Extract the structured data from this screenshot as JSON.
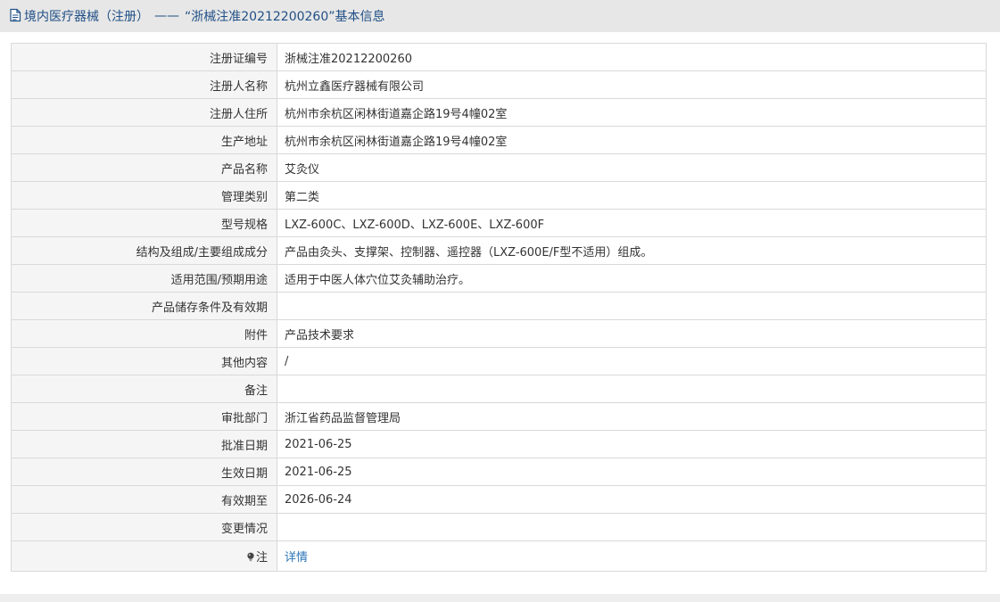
{
  "header": {
    "category": "境内医疗器械（注册）",
    "separator": "——",
    "title": "“浙械注准20212200260”基本信息",
    "icon": "document-icon"
  },
  "rows": [
    {
      "key": "registration-number",
      "label": "注册证编号",
      "value": "浙械注准20212200260"
    },
    {
      "key": "registrant-name",
      "label": "注册人名称",
      "value": "杭州立鑫医疗器械有限公司"
    },
    {
      "key": "registrant-address",
      "label": "注册人住所",
      "value": "杭州市余杭区闲林街道嘉企路19号4幢02室"
    },
    {
      "key": "production-address",
      "label": "生产地址",
      "value": "杭州市余杭区闲林街道嘉企路19号4幢02室"
    },
    {
      "key": "product-name",
      "label": "产品名称",
      "value": "艾灸仪"
    },
    {
      "key": "management-class",
      "label": "管理类别",
      "value": "第二类"
    },
    {
      "key": "model-spec",
      "label": "型号规格",
      "value": "LXZ-600C、LXZ-600D、LXZ-600E、LXZ-600F"
    },
    {
      "key": "structure-composition",
      "label": "结构及组成/主要组成成分",
      "value": "产品由灸头、支撑架、控制器、遥控器（LXZ-600E/F型不适用）组成。"
    },
    {
      "key": "scope-intended-use",
      "label": "适用范围/预期用途",
      "value": "适用于中医人体穴位艾灸辅助治疗。"
    },
    {
      "key": "storage-validity",
      "label": "产品储存条件及有效期",
      "value": ""
    },
    {
      "key": "attachment",
      "label": "附件",
      "value": "产品技术要求"
    },
    {
      "key": "other-content",
      "label": "其他内容",
      "value": "/"
    },
    {
      "key": "remarks",
      "label": "备注",
      "value": ""
    },
    {
      "key": "approval-department",
      "label": "审批部门",
      "value": "浙江省药品监督管理局"
    },
    {
      "key": "approval-date",
      "label": "批准日期",
      "value": "2021-06-25"
    },
    {
      "key": "effective-date",
      "label": "生效日期",
      "value": "2021-06-25"
    },
    {
      "key": "valid-until",
      "label": "有效期至",
      "value": "2026-06-24"
    },
    {
      "key": "change-status",
      "label": "变更情况",
      "value": ""
    }
  ],
  "note": {
    "label": "注",
    "icon": "bulb-icon",
    "link_text": "详情"
  }
}
